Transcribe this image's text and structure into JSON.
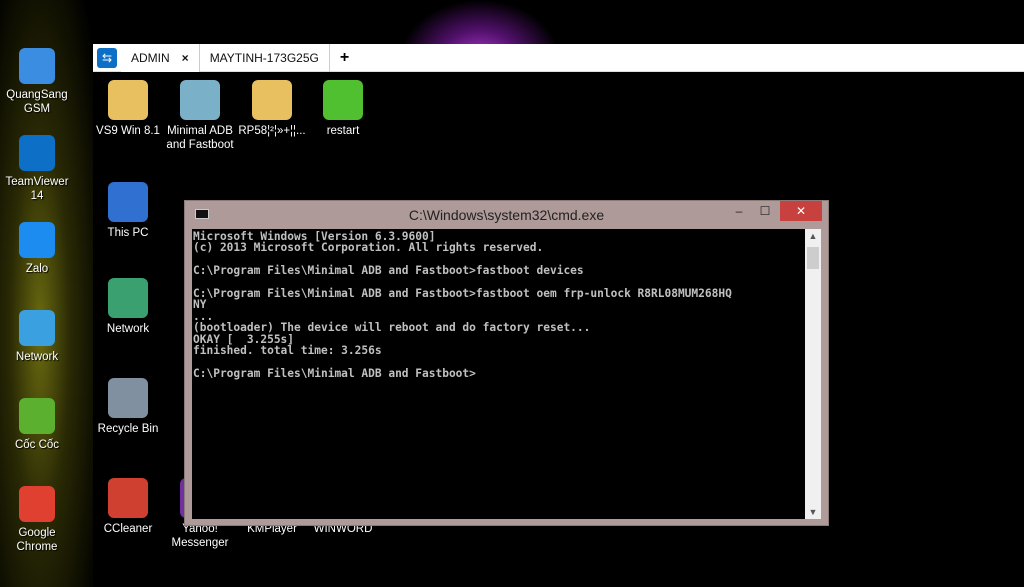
{
  "local_desktop": {
    "icons": [
      {
        "label": "QuangSang GSM",
        "icon": "monitor-icon",
        "color": "#3a8de0"
      },
      {
        "label": "TeamViewer 14",
        "icon": "teamviewer-icon",
        "color": "#0e6fc6"
      },
      {
        "label": "Zalo",
        "icon": "zalo-icon",
        "color": "#1c8cf0"
      },
      {
        "label": "Network",
        "icon": "network-icon",
        "color": "#3aa0e0"
      },
      {
        "label": "Cốc Cốc",
        "icon": "coccoc-icon",
        "color": "#5bb030"
      },
      {
        "label": "Google Chrome",
        "icon": "chrome-icon",
        "color": "#e04030"
      }
    ]
  },
  "teamviewer": {
    "tabs": [
      {
        "label": "ADMIN",
        "close": "×"
      },
      {
        "label": "MAYTINH-173G25G"
      }
    ],
    "new_tab": "+"
  },
  "remote_desktop": {
    "icons": [
      {
        "label": "VS9 Win 8.1",
        "color": "#e8c060"
      },
      {
        "label": "Minimal ADB and Fastboot",
        "color": "#7ab0c8"
      },
      {
        "label": "RP58¦²¦»+¦¦...",
        "color": "#e8c060"
      },
      {
        "label": "restart",
        "color": "#50c030"
      },
      {
        "label": "This PC",
        "color": "#3070d0"
      },
      {
        "label": "Network",
        "color": "#3aa070"
      },
      {
        "label": "Recycle Bin",
        "color": "#8090a0"
      },
      {
        "label": "CCleaner",
        "color": "#d04030"
      },
      {
        "label": "Yahoo! Messenger",
        "color": "#7030a0"
      },
      {
        "label": "KMPlayer",
        "color": "#000000"
      },
      {
        "label": "WINWORD",
        "color": "#000000"
      }
    ]
  },
  "cmd": {
    "title": "C:\\Windows\\system32\\cmd.exe",
    "minimize": "–",
    "maximize": "☐",
    "close": "✕",
    "lines": [
      "Microsoft Windows [Version 6.3.9600]",
      "(c) 2013 Microsoft Corporation. All rights reserved.",
      "",
      "C:\\Program Files\\Minimal ADB and Fastboot>fastboot devices",
      "",
      "C:\\Program Files\\Minimal ADB and Fastboot>fastboot oem frp-unlock R8RL08MUM268HQ",
      "NY",
      "...",
      "(bootloader) The device will reboot and do factory reset...",
      "OKAY [  3.255s]",
      "finished. total time: 3.256s",
      "",
      "C:\\Program Files\\Minimal ADB and Fastboot>"
    ]
  }
}
